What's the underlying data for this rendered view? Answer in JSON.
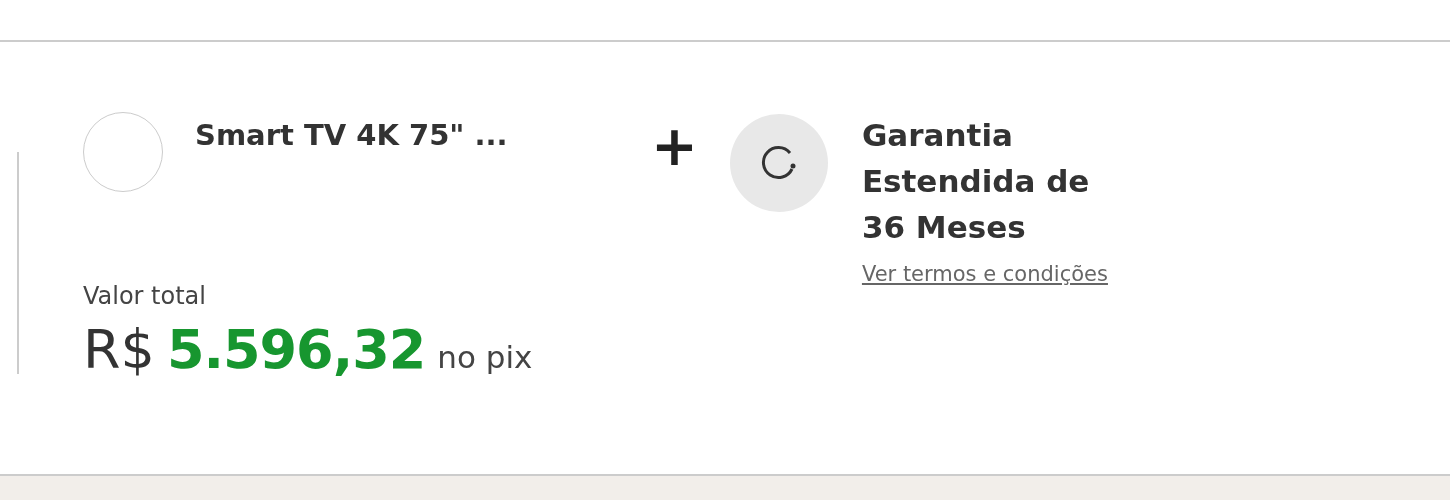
{
  "product": {
    "title": "Smart TV 4K 75\" ..."
  },
  "separator": "+",
  "warranty": {
    "title": "Garantia Estendida de 36 Meses",
    "link": "Ver termos e condições"
  },
  "total": {
    "label": "Valor total",
    "currency": "R$",
    "amount": "5.596,32",
    "suffix": "no pix"
  }
}
